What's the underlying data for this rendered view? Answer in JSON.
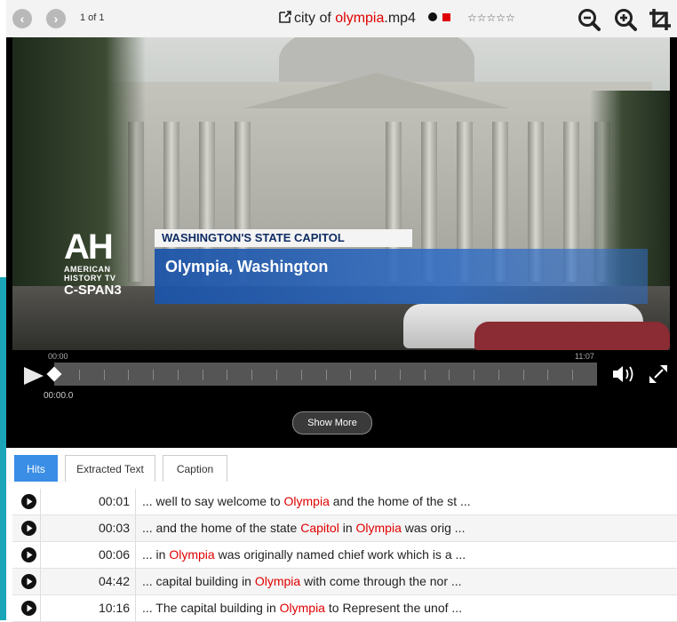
{
  "toolbar": {
    "page_counter": "1 of 1",
    "title_prefix": "city of ",
    "title_highlight": "olympia",
    "title_suffix": ".mp4",
    "rating_stars": "☆☆☆☆☆",
    "icons": [
      "back-arrow-icon",
      "forward-arrow-icon",
      "external-link-icon",
      "zoom-out-icon",
      "zoom-in-icon",
      "crop-icon"
    ]
  },
  "video": {
    "lower_third_top": "WASHINGTON'S STATE CAPITOL",
    "lower_third_main": "Olympia, Washington",
    "logo_big": "AH",
    "logo_line1": "AMERICAN",
    "logo_line2": "HISTORY TV",
    "logo_line3": "C-SPAN3"
  },
  "player": {
    "time_start": "00:00",
    "time_end": "11:07",
    "current_time": "00:00.0",
    "progress": 0,
    "show_more_label": "Show More"
  },
  "tabs": [
    {
      "label": "Hits",
      "active": true
    },
    {
      "label": "Extracted Text",
      "active": false
    },
    {
      "label": "Caption",
      "active": false
    }
  ],
  "hits": [
    {
      "time": "00:01",
      "parts": [
        [
          "... well to say welcome to ",
          false
        ],
        [
          "Olympia",
          true
        ],
        [
          " and the home of the st ...",
          false
        ]
      ]
    },
    {
      "time": "00:03",
      "parts": [
        [
          "... and the home of the state ",
          false
        ],
        [
          "Capitol",
          true
        ],
        [
          " in ",
          false
        ],
        [
          "Olympia",
          true
        ],
        [
          " was orig ...",
          false
        ]
      ]
    },
    {
      "time": "00:06",
      "parts": [
        [
          "... in ",
          false
        ],
        [
          "Olympia",
          true
        ],
        [
          " was originally named chief work which is a ...",
          false
        ]
      ]
    },
    {
      "time": "04:42",
      "parts": [
        [
          "... capital building in ",
          false
        ],
        [
          "Olympia",
          true
        ],
        [
          " with come through the nor ...",
          false
        ]
      ]
    },
    {
      "time": "10:16",
      "parts": [
        [
          "... The capital building in ",
          false
        ],
        [
          "Olympia",
          true
        ],
        [
          " to Represent the unof ...",
          false
        ]
      ]
    }
  ],
  "colors": {
    "highlight": "#e00000",
    "tab_active": "#3a8ee6",
    "accent": "#1aa5b8"
  }
}
